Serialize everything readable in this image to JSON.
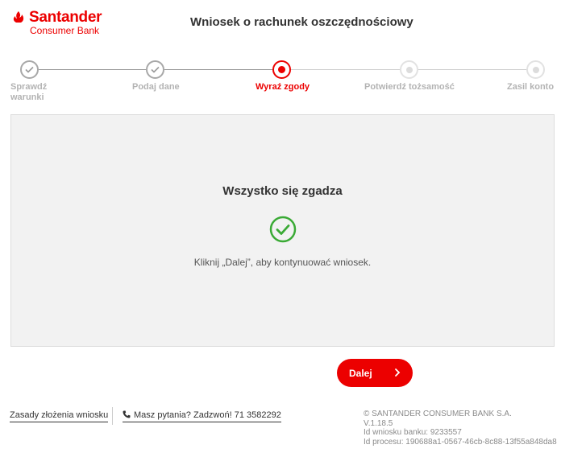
{
  "header": {
    "logo_name": "Santander",
    "logo_sub": "Consumer Bank",
    "title": "Wniosek o rachunek oszczędnościowy"
  },
  "stepper": {
    "steps": [
      {
        "label_line1": "Sprawdź",
        "label_line2": "warunki",
        "state": "done"
      },
      {
        "label_line1": "Podaj dane",
        "label_line2": "",
        "state": "done"
      },
      {
        "label_line1": "Wyraź zgody",
        "label_line2": "",
        "state": "active"
      },
      {
        "label_line1": "Potwierdź tożsamość",
        "label_line2": "",
        "state": "todo"
      },
      {
        "label_line1": "Zasil konto",
        "label_line2": "",
        "state": "todo"
      }
    ]
  },
  "panel": {
    "title": "Wszystko się zgadza",
    "message": "Kliknij „Dalej”, aby kontynuować wniosek."
  },
  "actions": {
    "next_label": "Dalej"
  },
  "footer": {
    "rules_link": "Zasady złożenia wniosku",
    "phone_link": "Masz pytania? Zadzwoń! 71 3582292",
    "copyright": "© SANTANDER CONSUMER BANK S.A.",
    "version": "V.1.18.5",
    "bank_id": "Id wniosku banku: 9233557",
    "process_id": "Id procesu: 190688a1-0567-46cb-8c88-13f55a848da8"
  },
  "colors": {
    "brand": "#ec0000",
    "success": "#3aaa35"
  }
}
